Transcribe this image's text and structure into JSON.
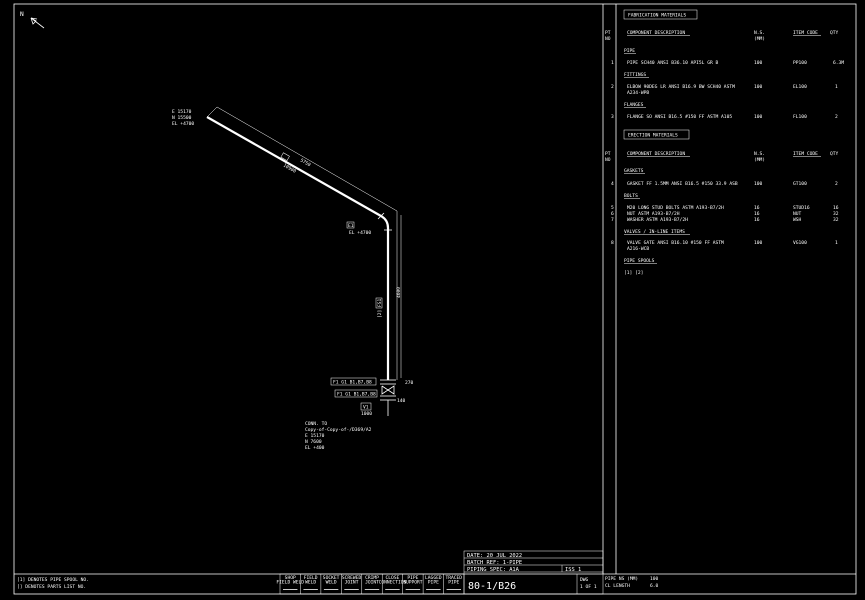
{
  "north_label": "N",
  "iso": {
    "start_coords": [
      "E 15170",
      "N 15500",
      "EL +4700"
    ],
    "dim_top_1": "5750",
    "dim_top_2": "10900",
    "elbow_label": "EL +4700",
    "elbow_tag": "E1",
    "dim_vertical": "4600",
    "spool_tag": "FS1",
    "spool_tag2": "[2]",
    "flange_tag_1": "F1 G1 B1,B7,B8",
    "flange_tag_2": "F1 G1 B1,B7,B8",
    "dim_small_1": "270",
    "dim_small_2": "140",
    "valve_tag": "V1",
    "small_num": "1000",
    "conn_lines": [
      "CONN. TO",
      "Copy-of-Copy-of-/D369/A2",
      "E 15170",
      "N 7600",
      "EL +400"
    ]
  },
  "fab": {
    "title": "FABRICATION MATERIALS",
    "hdr_pt": "PT",
    "hdr_no": "NO",
    "hdr_desc": "COMPONENT DESCRIPTION",
    "hdr_ns": "N.S.",
    "hdr_mm": "(MM)",
    "hdr_code": "ITEM CODE",
    "hdr_qty": "QTY",
    "sec_pipe": "PIPE",
    "row1": {
      "pt": "1",
      "desc": "PIPE SCH40 ANSI B36.10 API5L GR B",
      "ns": "100",
      "code": "PP100",
      "qty": "6.3M"
    },
    "sec_fittings": "FITTINGS",
    "row2": {
      "pt": "2",
      "desc1": "ELBOW 90DEG LR ANSI B16.9 BW SCH40 ASTM",
      "desc2": "A234-WPB",
      "ns": "100",
      "code": "EL100",
      "qty": "1"
    },
    "sec_flanges": "FLANGES",
    "row3": {
      "pt": "3",
      "desc": "FLANGE SO ANSI B16.5 #150 FF ASTM A105",
      "ns": "100",
      "code": "FL100",
      "qty": "2"
    }
  },
  "erec": {
    "title": "ERECTION MATERIALS",
    "sec_gaskets": "GASKETS",
    "row4": {
      "pt": "4",
      "desc": "GASKET FF 1.5MM ANSI B16.5 #150 33.9 ASB",
      "ns": "100",
      "code": "GT100",
      "qty": "2"
    },
    "sec_bolts": "BOLTS",
    "row5": {
      "pt": "5",
      "desc": "M20 LONG STUD BOLTS ASTM A193-B7/2H",
      "ns": "16",
      "code": "STUD16",
      "qty": "16"
    },
    "row6": {
      "pt": "6",
      "desc": "NUT ASTM A193-B7/2H",
      "ns": "16",
      "code": "NUT",
      "qty": "32"
    },
    "row7": {
      "pt": "7",
      "desc": "WASHER ASTM A193-B7/2H",
      "ns": "16",
      "code": "WSH",
      "qty": "32"
    },
    "sec_valves": "VALVES / IN-LINE ITEMS",
    "row8": {
      "pt": "8",
      "desc1": "VALVE GATE ANSI B16.10 #150 FF ASTM",
      "desc2": "A216-WCB",
      "ns": "100",
      "code": "VG100",
      "qty": "1"
    },
    "sec_spools": "PIPE SPOOLS",
    "spools": "[1]  [2]"
  },
  "footer": {
    "note1": "[1] DENOTES PIPE SPOOL NO.",
    "note2": "[] DENOTES PARTS LIST NO.",
    "legend": [
      [
        "SHOP",
        "FIELD WELD"
      ],
      [
        "FIELD",
        "WELD"
      ],
      [
        "SOCKET",
        "WELD"
      ],
      [
        "SCREWED",
        "JOINT"
      ],
      [
        "CRIMP",
        "JOINT"
      ],
      [
        "CLOSE",
        "CONNECTION"
      ],
      [
        "PIPE",
        "SUPPORT"
      ],
      [
        "LAGGED",
        "PIPE"
      ],
      [
        "TRACED",
        "PIPE"
      ]
    ],
    "date": "DATE: 20 JUL 2022",
    "batch": "BATCH REF: 1-PIPE",
    "spec": "PIPING SPEC: A1A",
    "iso_no": "80-1/B26",
    "rev": "ISS  1",
    "dwg": "DWG",
    "dwg_of": "1 OF 1",
    "pipe_ns_label": "PIPE NS (MM)",
    "pipe_ns_value": "100",
    "cl_length_label": "CL LENGTH",
    "cl_length_value": "6.0"
  }
}
